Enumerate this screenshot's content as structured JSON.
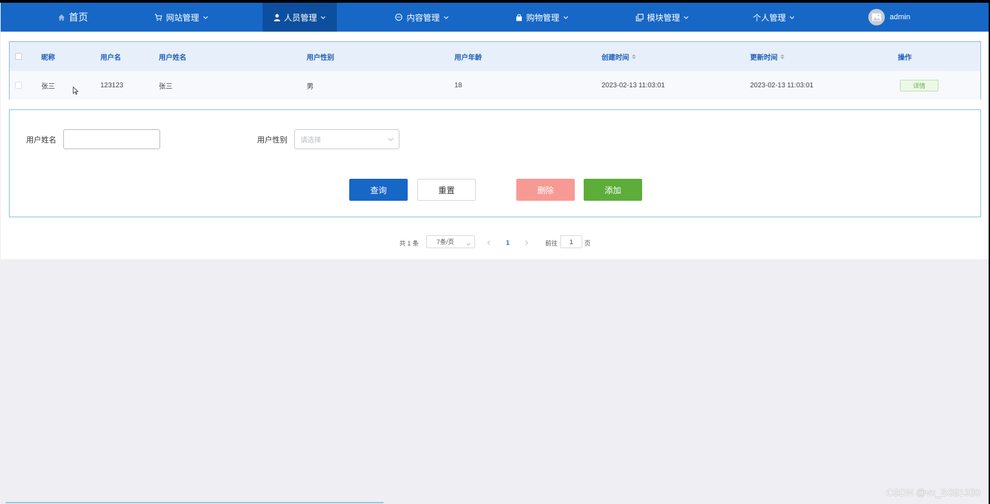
{
  "nav": {
    "home": "首页",
    "items": [
      {
        "label": "网站管理"
      },
      {
        "label": "人员管理"
      },
      {
        "label": "内容管理"
      },
      {
        "label": "购物管理"
      },
      {
        "label": "模块管理"
      },
      {
        "label": "个人管理"
      }
    ],
    "active_index": 1,
    "user": "admin"
  },
  "table": {
    "headers": {
      "nickname": "昵称",
      "username": "用户名",
      "realname": "用户姓名",
      "gender": "用户性别",
      "age": "用户年龄",
      "created": "创建时间",
      "updated": "更新时间",
      "actions": "操作"
    },
    "rows": [
      {
        "nickname": "张三",
        "username": "123123",
        "realname": "张三",
        "gender": "男",
        "age": "18",
        "created": "2023-02-13 11:03:01",
        "updated": "2023-02-13 11:03:01",
        "action": "详情"
      }
    ]
  },
  "search": {
    "name_label": "用户姓名",
    "name_value": "",
    "gender_label": "用户性别",
    "gender_placeholder": "请选择",
    "query": "查询",
    "reset": "重置",
    "delete": "删除",
    "add": "添加"
  },
  "pagination": {
    "total": "共 1 条",
    "page_size": "7条/页",
    "current_page": "1",
    "goto_label": "前往",
    "goto_value": "1",
    "page_unit": "页"
  },
  "watermark": "CSDN @vx_BS81330",
  "colors": {
    "nav_bg": "#1767c7",
    "nav_active": "#0d4f9e",
    "header_text": "#1d5fb5",
    "delete": "#f89a94",
    "add": "#5dad3a"
  }
}
